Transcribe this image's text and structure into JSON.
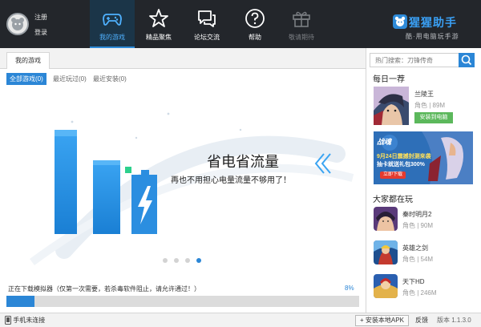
{
  "user": {
    "register": "注册",
    "login": "登录"
  },
  "nav": [
    {
      "label": "我的游戏",
      "icon": "gamepad-icon",
      "active": true
    },
    {
      "label": "精品聚焦",
      "icon": "star-icon"
    },
    {
      "label": "论坛交流",
      "icon": "chat-icon"
    },
    {
      "label": "帮助",
      "icon": "help-icon"
    },
    {
      "label": "敬请期待",
      "icon": "gift-icon",
      "disabled": true
    }
  ],
  "brand": {
    "name": "猩猩助手",
    "slogan": "酷·用电脑玩手游"
  },
  "tabs": {
    "main": "我的游戏"
  },
  "subtabs": [
    "全部游戏(0)",
    "最近玩过(0)",
    "最近安装(0)"
  ],
  "banner": {
    "headline": "省电省流量",
    "subhead": "再也不用担心电量流量不够用了！",
    "slides": 4,
    "active_slide": 3
  },
  "download": {
    "status": "正在下载模拟器（仅第一次需要，若杀毒软件阻止，请允许通过！）",
    "percent_label": "8%",
    "percent": 8
  },
  "sidebar": {
    "search_placeholder": "热门搜索：刀锋传奇",
    "daily_title": "每日一荐",
    "featured": {
      "name": "兰陵王",
      "meta": "角色 | 89M",
      "install": "安装到电脑"
    },
    "promo": {
      "brand": "战魂",
      "line1": "9月24日震撼封测来袭",
      "line2": "抽卡就送礼包300%",
      "button": "立即下载"
    },
    "popular_title": "大家都在玩",
    "games": [
      {
        "name": "秦时明月2",
        "meta": "角色 | 90M"
      },
      {
        "name": "英雄之剑",
        "meta": "角色 | 54M"
      },
      {
        "name": "天下HD",
        "meta": "角色 | 246M"
      }
    ]
  },
  "footer": {
    "phone": "手机未连接",
    "apk": "安装本地APK",
    "feedback": "反馈",
    "version": "版本 1.1.3.0"
  },
  "colors": {
    "accent": "#2b86d6",
    "topbar": "#23262b",
    "install": "#5cb85c"
  }
}
